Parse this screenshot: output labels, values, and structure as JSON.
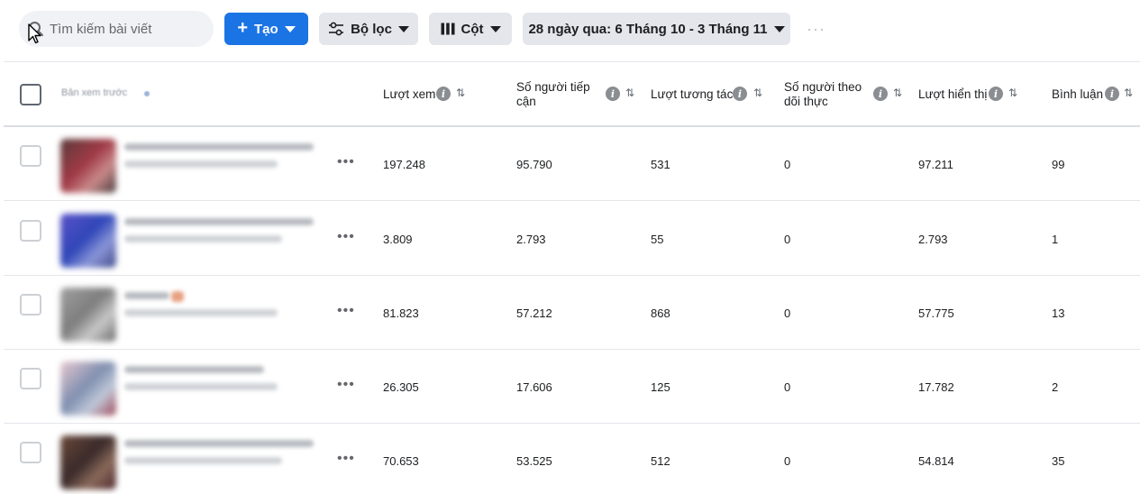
{
  "toolbar": {
    "search_placeholder": "Tìm kiếm bài viết",
    "create_label": "Tạo",
    "filter_label": "Bộ lọc",
    "columns_label": "Cột",
    "date_range_label": "28 ngày qua: 6 Tháng 10 - 3 Tháng 11",
    "more_label": "···"
  },
  "table": {
    "preview_header": "Bản xem trước",
    "columns": [
      {
        "key": "views",
        "label": "Lượt xem"
      },
      {
        "key": "reach",
        "label": "Số người tiếp cận"
      },
      {
        "key": "engagement",
        "label": "Lượt tương tác"
      },
      {
        "key": "followers",
        "label": "Số người theo dõi thực"
      },
      {
        "key": "impressions",
        "label": "Lượt hiển thị"
      },
      {
        "key": "comments",
        "label": "Bình luận"
      }
    ],
    "row_more_label": "•••",
    "rows": [
      {
        "views": "197.248",
        "reach": "95.790",
        "engagement": "531",
        "followers": "0",
        "impressions": "97.211",
        "comments": "99"
      },
      {
        "views": "3.809",
        "reach": "2.793",
        "engagement": "55",
        "followers": "0",
        "impressions": "2.793",
        "comments": "1"
      },
      {
        "views": "81.823",
        "reach": "57.212",
        "engagement": "868",
        "followers": "0",
        "impressions": "57.775",
        "comments": "13"
      },
      {
        "views": "26.305",
        "reach": "17.606",
        "engagement": "125",
        "followers": "0",
        "impressions": "17.782",
        "comments": "2"
      },
      {
        "views": "70.653",
        "reach": "53.525",
        "engagement": "512",
        "followers": "0",
        "impressions": "54.814",
        "comments": "35"
      }
    ]
  },
  "colors": {
    "primary": "#1b74e4",
    "gray_button": "#e4e6eb",
    "text": "#1c1e21"
  }
}
